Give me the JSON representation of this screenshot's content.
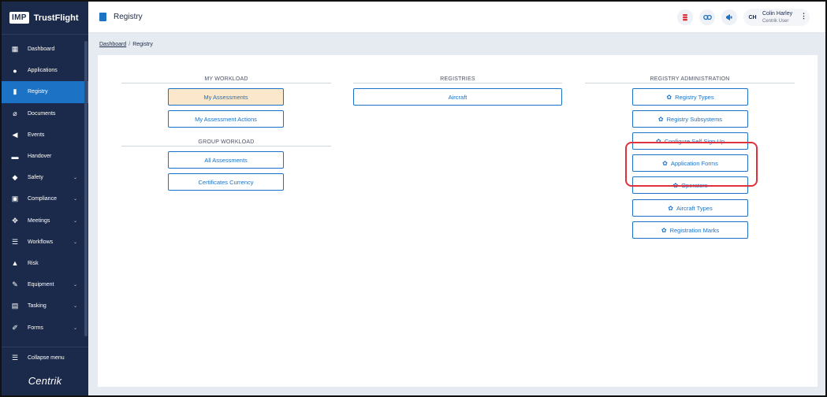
{
  "brand": {
    "logo": "IMP",
    "name": "TrustFlight"
  },
  "sidebar": {
    "items": [
      {
        "label": "Dashboard",
        "icon": "dashboard-icon",
        "glyph": "▦",
        "chevron": ""
      },
      {
        "label": "Applications",
        "icon": "person-icon",
        "glyph": "●",
        "chevron": ""
      },
      {
        "label": "Registry",
        "icon": "book-icon",
        "glyph": "▮",
        "chevron": "",
        "active": true
      },
      {
        "label": "Documents",
        "icon": "paperclip-icon",
        "glyph": "⌀",
        "chevron": ""
      },
      {
        "label": "Events",
        "icon": "megaphone-icon",
        "glyph": "◀",
        "chevron": ""
      },
      {
        "label": "Handover",
        "icon": "mail-icon",
        "glyph": "▬",
        "chevron": ""
      },
      {
        "label": "Safety",
        "icon": "shield-icon",
        "glyph": "◆",
        "chevron": "⌄"
      },
      {
        "label": "Compliance",
        "icon": "clipboard-icon",
        "glyph": "▣",
        "chevron": "⌄"
      },
      {
        "label": "Meetings",
        "icon": "people-icon",
        "glyph": "✥",
        "chevron": "⌄"
      },
      {
        "label": "Workflows",
        "icon": "workflow-icon",
        "glyph": "☰",
        "chevron": "⌄"
      },
      {
        "label": "Risk",
        "icon": "warning-icon",
        "glyph": "▲",
        "chevron": ""
      },
      {
        "label": "Equipment",
        "icon": "wrench-icon",
        "glyph": "✎",
        "chevron": "⌄"
      },
      {
        "label": "Tasking",
        "icon": "task-icon",
        "glyph": "▤",
        "chevron": "⌄"
      },
      {
        "label": "Forms",
        "icon": "forms-icon",
        "glyph": "✐",
        "chevron": "⌄"
      }
    ],
    "collapse_label": "Collapse menu",
    "collapse_glyph": "☰",
    "footer_logo": "Centrik"
  },
  "topbar": {
    "title": "Registry",
    "user": {
      "initials": "CH",
      "name": "Colin Harley",
      "role": "Centrik User"
    }
  },
  "breadcrumb": {
    "home": "Dashboard",
    "separator": "/",
    "current": "Registry"
  },
  "columns": {
    "workload": {
      "my_heading": "MY WORKLOAD",
      "my_assessments": "My Assessments",
      "my_assessment_actions": "My Assessment Actions",
      "group_heading": "GROUP WORKLOAD",
      "all_assessments": "All Assessments",
      "certificates_currency": "Certificates Currency"
    },
    "registries": {
      "heading": "REGISTRIES",
      "aircraft": "Aircraft"
    },
    "admin": {
      "heading": "REGISTRY ADMINISTRATION",
      "registry_types": "Registry Types",
      "registry_subsystems": "Registry Subsystems",
      "configure_self_sign_up": "Configure Self Sign Up",
      "application_forms": "Application Forms",
      "operators": "Operators",
      "aircraft_types": "Aircraft Types",
      "registration_marks": "Registration Marks"
    }
  },
  "colors": {
    "sidebar_bg": "#1b2a4a",
    "accent": "#1c72c4",
    "selected_button_bg": "#fbe8cc",
    "highlight": "#e0313f"
  }
}
